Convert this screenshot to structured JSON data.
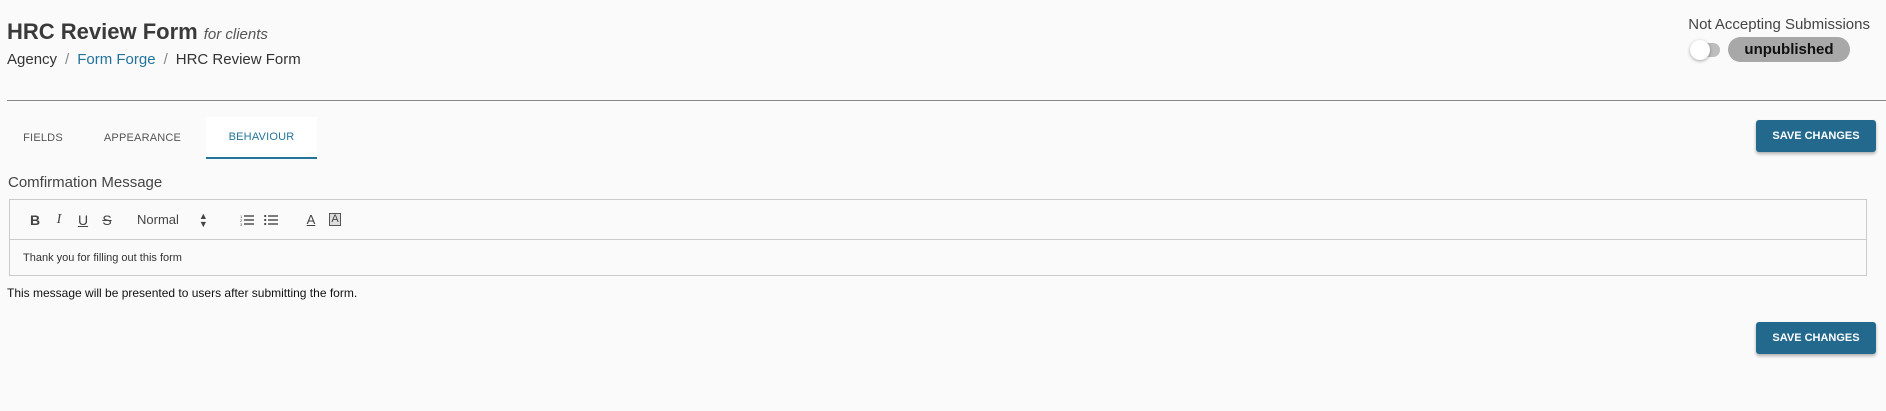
{
  "header": {
    "title": "HRC Review Form",
    "subtitle": "for clients",
    "breadcrumb": [
      {
        "label": "Agency"
      },
      {
        "label": "Form Forge"
      },
      {
        "label": "HRC Review Form"
      }
    ],
    "breadcrumb_separator": "/"
  },
  "status": {
    "text": "Not Accepting Submissions",
    "toggle_on": false,
    "badge": "unpublished"
  },
  "tabs": [
    {
      "label": "FIELDS",
      "active": false
    },
    {
      "label": "APPEARANCE",
      "active": false
    },
    {
      "label": "BEHAVIOUR",
      "active": true
    }
  ],
  "actions": {
    "save_label": "SAVE CHANGES"
  },
  "editor": {
    "label": "Comfirmation Message",
    "toolbar": {
      "bold": "B",
      "italic": "I",
      "underline": "U",
      "strike": "S",
      "format_select": "Normal",
      "font_color": "A",
      "background_color": "A"
    },
    "content": "Thank you for filling out this form",
    "helper_text": "This message will be presented to users after submitting the form."
  },
  "colors": {
    "accent": "#23739a",
    "button": "#23698e",
    "badge": "#a8a8a8"
  }
}
